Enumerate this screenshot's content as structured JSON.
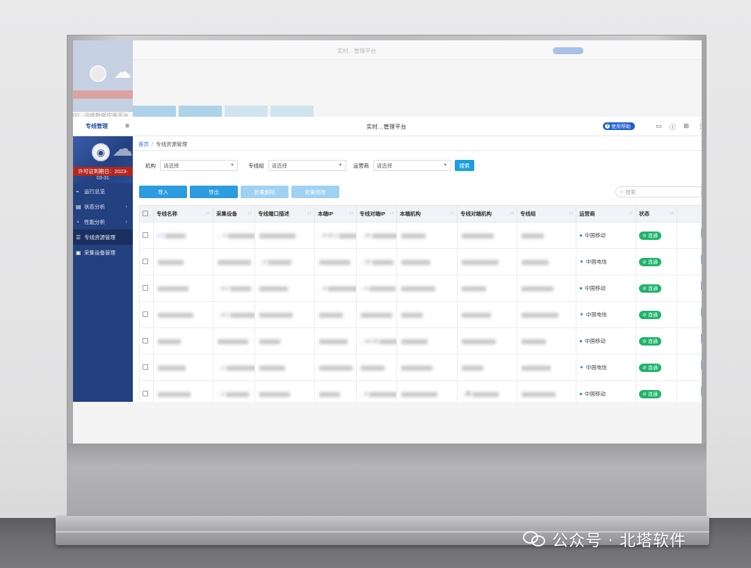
{
  "app": {
    "sidebar_title": "专线管理",
    "page_title": "实时…管理平台",
    "help_label": "使用帮助",
    "license_text": "许可证到期日：2023-",
    "license_date": "03-31",
    "ghost_breadcrumb": "首页 / 专线资源管理",
    "ghost_menu": "运行总览",
    "ghost_header": "00 - 运维数据应用平台"
  },
  "sidebar": {
    "items": [
      {
        "icon": "activity-icon",
        "glyph": "⌁",
        "label": "运行总览"
      },
      {
        "icon": "chart-icon",
        "glyph": "▤",
        "label": "状态分析",
        "arrow": "›"
      },
      {
        "icon": "gauge-icon",
        "glyph": "◔",
        "label": "性能分析",
        "arrow": "›"
      },
      {
        "icon": "list-icon",
        "glyph": "☰",
        "label": "专线资源管理"
      },
      {
        "icon": "device-icon",
        "glyph": "▣",
        "label": "采集设备管理"
      }
    ]
  },
  "breadcrumb": {
    "home": "首页",
    "sep": "/",
    "current": "专线资源管理"
  },
  "filters": [
    {
      "label": "机构",
      "placeholder": "请选择"
    },
    {
      "label": "专线组",
      "placeholder": "请选择"
    },
    {
      "label": "运营商",
      "placeholder": "请选择"
    }
  ],
  "search_button": "搜索",
  "actions": [
    "导入",
    "导出",
    "批量删除",
    "批量修改"
  ],
  "table_search_placeholder": "搜索",
  "table": {
    "columns": [
      "专线名称",
      "采集设备",
      "专线端口描述",
      "本端IP",
      "专线对端IP",
      "本端机构",
      "专线对端机构",
      "专线组",
      "运营商",
      "状态"
    ],
    "rows": [
      {
        "name": "1.1",
        "device": "…-1",
        "desc": "",
        "local_ip": "…9.10.1",
        "peer_ip": "…10",
        "local_org": "",
        "peer_org": "",
        "group": "",
        "carrier": "中国移动",
        "status": "连通"
      },
      {
        "name": "",
        "device": "",
        "desc": "…0",
        "local_ip": "",
        "peer_ip": "…10",
        "local_org": "",
        "peer_org": "",
        "group": "",
        "carrier": "中国电信",
        "status": "连通"
      },
      {
        "name": "",
        "device": "…6.2",
        "desc": "",
        "local_ip": "…3",
        "peer_ip": "…0",
        "local_org": "",
        "peer_org": "",
        "group": "",
        "carrier": "中国移动",
        "status": "连通"
      },
      {
        "name": "",
        "device": "…8.1",
        "desc": "",
        "local_ip": "",
        "peer_ip": "",
        "local_org": "",
        "peer_org": "",
        "group": "",
        "carrier": "中国电信",
        "status": "连通"
      },
      {
        "name": "",
        "device": "",
        "desc": "",
        "local_ip": "",
        "peer_ip": "…10.15",
        "local_org": "",
        "peer_org": "",
        "group": "",
        "carrier": "中国移动",
        "status": "连通"
      },
      {
        "name": "",
        "device": "…1",
        "desc": "",
        "local_ip": "",
        "peer_ip": "",
        "local_org": "",
        "peer_org": "",
        "group": "",
        "carrier": "中国电信",
        "status": "连通"
      },
      {
        "name": "",
        "device": "…2",
        "desc": "",
        "local_ip": "",
        "peer_ip": "…6",
        "local_org": "",
        "peer_org": "…网",
        "group": "",
        "carrier": "中国移动",
        "status": "连通"
      }
    ]
  },
  "watermark": "公众号 · 北塔软件",
  "colors": {
    "sidebar": "#23407f",
    "accent": "#2c9be0",
    "status_ok": "#1fb36b",
    "license": "#b3261e"
  }
}
